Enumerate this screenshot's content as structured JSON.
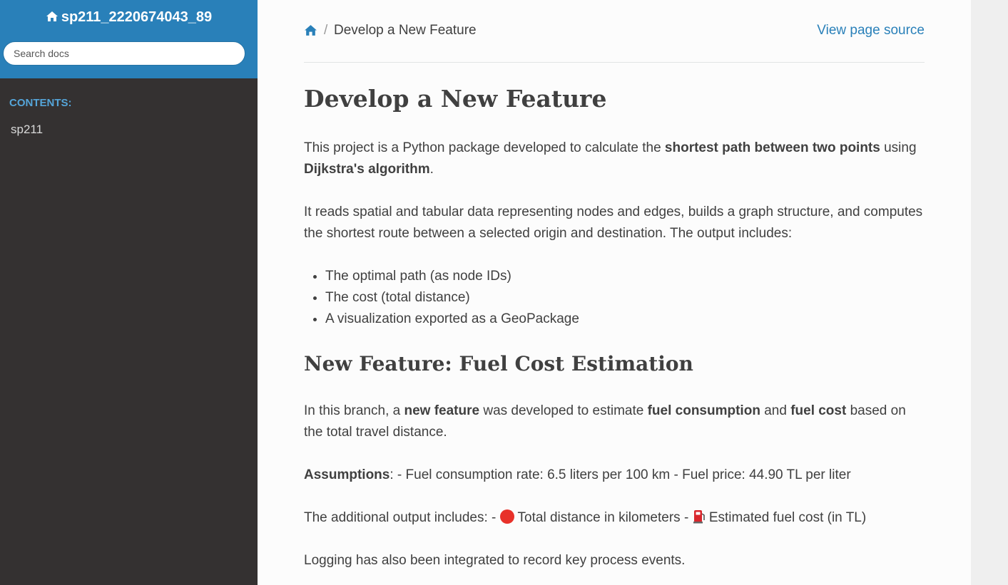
{
  "sidebar": {
    "project_title": "sp211_2220674043_89",
    "search_placeholder": "Search docs",
    "caption": "CONTENTS:",
    "nav_items": [
      "sp211"
    ]
  },
  "breadcrumb": {
    "current": "Develop a New Feature",
    "view_source": "View page source"
  },
  "page": {
    "title": "Develop a New Feature",
    "intro": {
      "before": "This project is a Python package developed to calculate the ",
      "bold1": "shortest path between two points",
      "mid": " using ",
      "bold2": "Dijkstra's algorithm",
      "after": "."
    },
    "para2": "It reads spatial and tabular data representing nodes and edges, builds a graph structure, and computes the shortest route between a selected origin and destination. The output includes:",
    "bullets": [
      "The optimal path (as node IDs)",
      "The cost (total distance)",
      "A visualization exported as a GeoPackage"
    ],
    "section_title": "New Feature: Fuel Cost Estimation",
    "feature": {
      "t1": "In this branch, a ",
      "b1": "new feature",
      "t2": " was developed to estimate ",
      "b2": "fuel consumption",
      "t3": " and ",
      "b3": "fuel cost",
      "t4": " based on the total travel distance."
    },
    "assumptions": {
      "label": "Assumptions",
      "text": ": - Fuel consumption rate: 6.5 liters per 100 km - Fuel price: 44.90 TL per liter"
    },
    "additional": {
      "t1": "The additional output includes: - ",
      "t2": " Total distance in kilometers - ",
      "t3": " Estimated fuel cost (in TL)"
    },
    "logging": "Logging has also been integrated to record key process events."
  },
  "colors": {
    "sidebar_top": "#2980b9",
    "sidebar_bg": "#343131",
    "caption": "#55a5d9",
    "link": "#2980b9",
    "content_bg": "#fcfcfc"
  }
}
